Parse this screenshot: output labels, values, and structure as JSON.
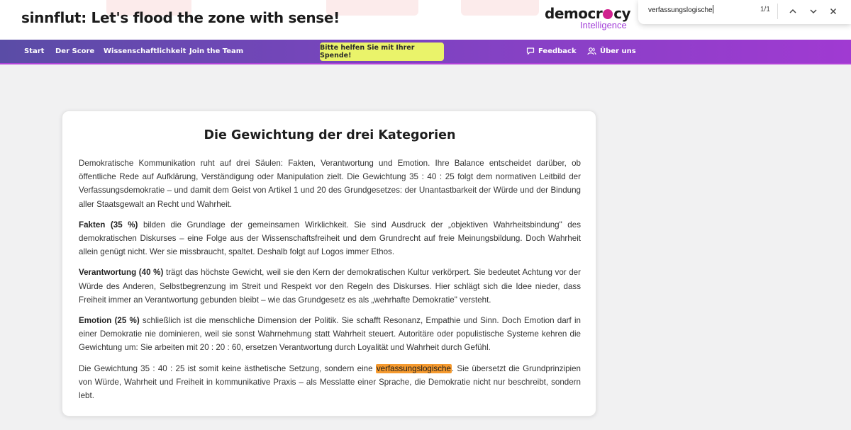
{
  "header": {
    "site_title": "sinnflut: Let's flood the zone with sense!",
    "logo_main_pre": "democr",
    "logo_main_post": "cy",
    "logo_sub": "Intelligence"
  },
  "findbar": {
    "query": "verfassungslogische",
    "count": "1/1"
  },
  "nav": {
    "items": [
      "Start",
      "Der Score",
      "Wissenschaftlichkeit",
      "Join the Team"
    ],
    "donate": "Bitte helfen Sie mit Ihrer Spende!",
    "feedback": "Feedback",
    "about": "Über uns"
  },
  "colors": {
    "accent": "#a03ad2",
    "donate_bg": "#eaf36a",
    "highlight": "#f59a2f",
    "logo_dot": "#d0218e"
  },
  "article": {
    "title": "Die Gewichtung der drei Kategorien",
    "p1": "Demokratische Kommunikation ruht auf drei Säulen: Fakten, Verantwortung und Emotion. Ihre Balance entscheidet darüber, ob öffentliche Rede auf Aufklärung, Verständigung oder Manipulation zielt. Die Gewichtung 35 : 40 : 25 folgt dem normativen Leitbild der Verfassungsdemokratie – und damit dem Geist von Artikel 1 und 20 des Grundgesetzes: der Unantastbarkeit der Würde und der Bindung aller Staatsgewalt an Recht und Wahrheit.",
    "p2_bold": "Fakten (35 %)",
    "p2_text": " bilden die Grundlage der gemeinsamen Wirklichkeit. Sie sind Ausdruck der „objektiven Wahrheitsbindung\" des demokratischen Diskurses – eine Folge aus der Wissenschaftsfreiheit und dem Grundrecht auf freie Meinungsbildung. Doch Wahrheit allein genügt nicht. Wer sie missbraucht, spaltet. Deshalb folgt auf Logos immer Ethos.",
    "p3_bold": "Verantwortung (40 %)",
    "p3_text": " trägt das höchste Gewicht, weil sie den Kern der demokratischen Kultur verkörpert. Sie bedeutet Achtung vor der Würde des Anderen, Selbstbegrenzung im Streit und Respekt vor den Regeln des Diskurses. Hier schlägt sich die Idee nieder, dass Freiheit immer an Verantwortung gebunden bleibt – wie das Grundgesetz es als „wehrhafte Demokratie\" versteht.",
    "p4_bold": "Emotion (25 %)",
    "p4_text": " schließlich ist die menschliche Dimension der Politik. Sie schafft Resonanz, Empathie und Sinn. Doch Emotion darf in einer Demokratie nie dominieren, weil sie sonst Wahrnehmung statt Wahrheit steuert. Autoritäre oder populistische Systeme kehren die Gewichtung um: Sie arbeiten mit 20 : 20 : 60, ersetzen Verantwortung durch Loyalität und Wahrheit durch Gefühl.",
    "p5_pre": "Die Gewichtung 35 : 40 : 25 ist somit keine ästhetische Setzung, sondern eine ",
    "p5_highlight": "verfassungslogische",
    "p5_post": ". Sie übersetzt die Grundprinzipien von Würde, Wahrheit und Freiheit in kommunikative Praxis – als Messlatte einer Sprache, die Demokratie nicht nur beschreibt, sondern lebt."
  }
}
